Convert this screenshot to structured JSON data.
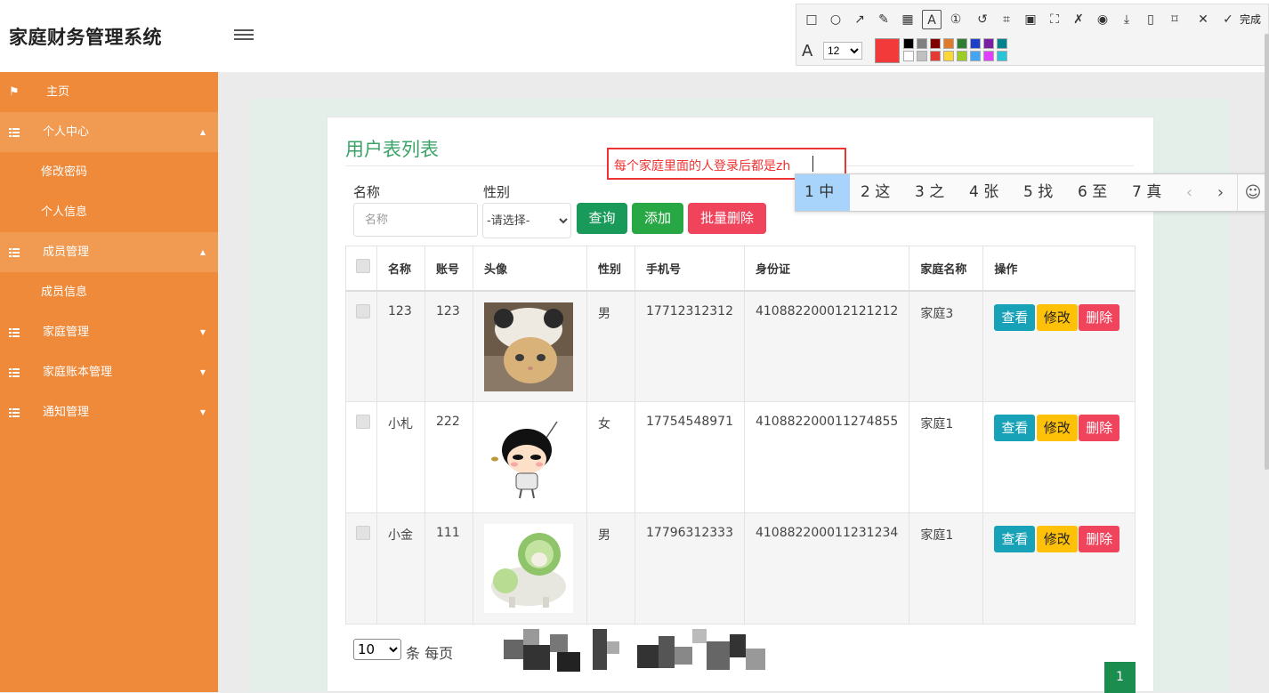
{
  "header": {
    "title": "家庭财务管理系统",
    "avatar_text": "80x80"
  },
  "sidebar": {
    "home": "主页",
    "personal": {
      "label": "个人中心",
      "children": [
        "修改密码",
        "个人信息"
      ]
    },
    "members": {
      "label": "成员管理",
      "children": [
        "成员信息"
      ]
    },
    "family": "家庭管理",
    "ledger": "家庭账本管理",
    "notice": "通知管理"
  },
  "page": {
    "title": "用户表列表",
    "filters": {
      "name_label": "名称",
      "name_placeholder": "名称",
      "sex_label": "性别",
      "sex_selected": "-请选择-"
    },
    "buttons": {
      "query": "查询",
      "add": "添加",
      "batch_delete": "批量删除"
    },
    "table": {
      "headers": [
        "名称",
        "账号",
        "头像",
        "性别",
        "手机号",
        "身份证",
        "家庭名称",
        "操作"
      ],
      "rows": [
        {
          "name": "123",
          "account": "123",
          "sex": "男",
          "phone": "17712312312",
          "id_card": "410882200012121212",
          "family": "家庭3"
        },
        {
          "name": "小札",
          "account": "222",
          "sex": "女",
          "phone": "17754548971",
          "id_card": "410882200011274855",
          "family": "家庭1"
        },
        {
          "name": "小金",
          "account": "111",
          "sex": "男",
          "phone": "17796312333",
          "id_card": "410882200011231234",
          "family": "家庭1"
        }
      ],
      "actions": {
        "view": "查看",
        "edit": "修改",
        "delete": "删除"
      }
    },
    "pagination": {
      "page_size": "10",
      "per_page_label": "条 每页",
      "current": "1"
    }
  },
  "overlay": {
    "annotation_text": "每个家庭里面的人登录后都是zh",
    "font_size": "12",
    "done_label": "完成",
    "ime_candidates": [
      "1 中",
      "2 这",
      "3 之",
      "4 张",
      "5 找",
      "6 至",
      "7 真"
    ]
  },
  "colors": {
    "sidebar": "#ee8a3a",
    "accent_green": "#3aa367",
    "danger": "#f0435c",
    "warning": "#ffc107",
    "info": "#17a2b8"
  }
}
